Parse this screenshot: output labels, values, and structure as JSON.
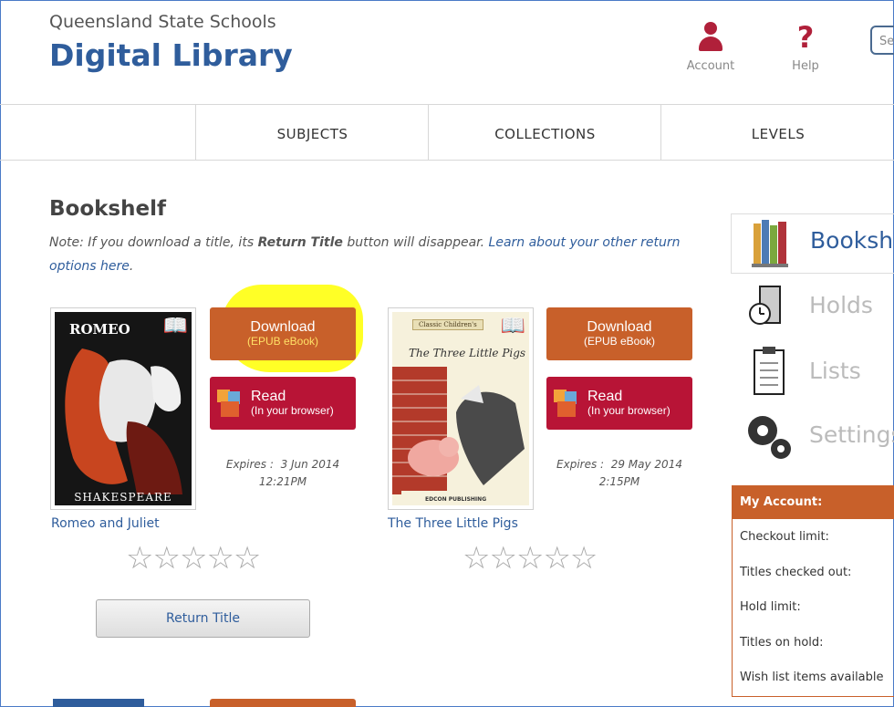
{
  "header": {
    "subtitle": "Queensland State Schools",
    "title": "Digital Library",
    "account_label": "Account",
    "help_label": "Help",
    "search_placeholder": "Se"
  },
  "nav": {
    "items": [
      "SUBJECTS",
      "COLLECTIONS",
      "LEVELS"
    ]
  },
  "bookshelf": {
    "title": "Bookshelf",
    "note_prefix": "Note: If you download a title, its ",
    "note_bold": "Return Title",
    "note_mid": " button will disappear. ",
    "note_link": "Learn about your other return options here",
    "note_suffix": ".",
    "books": [
      {
        "title": "Romeo and Juliet",
        "cover_top": "ROMEO",
        "cover_bottom": "SHAKESPEARE",
        "download_label": "Download",
        "download_sub": "(EPUB eBook)",
        "read_label": "Read",
        "read_sub": "(In your browser)",
        "expires_label": "Expires :",
        "expires_date": "3 Jun 2014",
        "expires_time": "12:21PM",
        "rating": 0
      },
      {
        "title": "The Three Little Pigs",
        "cover_banner": "Classic Children's",
        "cover_title": "The Three Little Pigs",
        "cover_publisher": "EDCON PUBLISHING",
        "download_label": "Download",
        "download_sub": "(EPUB eBook)",
        "read_label": "Read",
        "read_sub": "(In your browser)",
        "expires_label": "Expires :",
        "expires_date": "29 May 2014",
        "expires_time": "2:15PM",
        "rating": 0
      }
    ],
    "return_button": "Return Title"
  },
  "sidebar": {
    "items": [
      "Booksh",
      "Holds",
      "Lists",
      "Settings"
    ],
    "my_account": {
      "title": "My Account:",
      "rows": [
        "Checkout limit:",
        "Titles checked out:",
        "Hold limit:",
        "Titles on hold:",
        "Wish list items available"
      ]
    }
  },
  "colors": {
    "brand_blue": "#2f5d9c",
    "download_orange": "#c8602a",
    "read_red": "#b81436",
    "highlight": "#ffff00"
  }
}
